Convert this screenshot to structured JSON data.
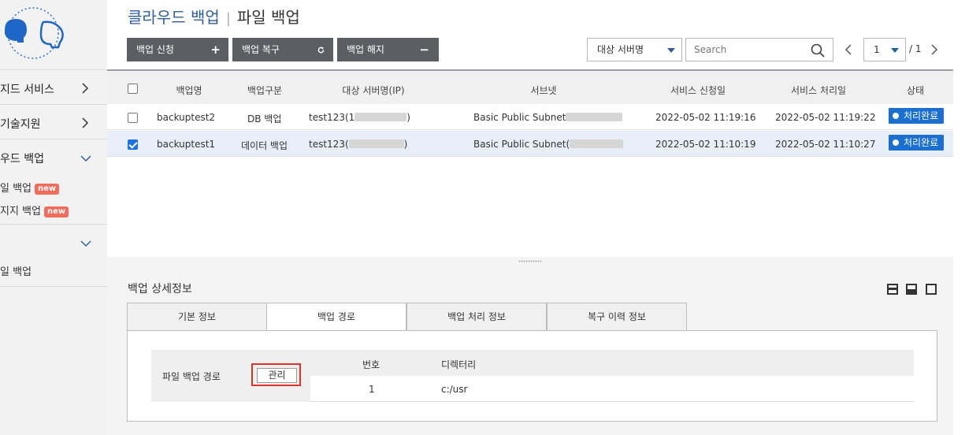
{
  "sidebar": {
    "items": [
      {
        "label": "지드 서비스"
      },
      {
        "label": "기술지원"
      },
      {
        "label": "우드 백업"
      }
    ],
    "sub_items": [
      {
        "label": "일 백업",
        "badge": "new"
      },
      {
        "label": "지지 백업",
        "badge": "new"
      }
    ],
    "bottom_item": {
      "label": "일 백업"
    }
  },
  "header": {
    "title": "클라우드 백업",
    "subtitle": "파일 백업"
  },
  "toolbar": {
    "apply_label": "백업 신청",
    "restore_label": "백업 복구",
    "cancel_label": "백업 해지",
    "server_select": "대상 서버명",
    "search_placeholder": "Search",
    "page_current": "1",
    "page_total": "/ 1"
  },
  "grid": {
    "columns": [
      "백업명",
      "백업구분",
      "대상 서버명(IP)",
      "서브넷",
      "서비스 신청일",
      "서비스 처리일",
      "상태"
    ],
    "rows": [
      {
        "name": "backuptest2",
        "type": "DB 백업",
        "server_pre": "test123(1",
        "server_post": ")",
        "subnet": "Basic Public Subnet",
        "applied": "2022-05-02 11:19:16",
        "processed": "2022-05-02 11:19:22",
        "status": "처리완료",
        "checked": false
      },
      {
        "name": "backuptest1",
        "type": "데이터 백업",
        "server_pre": "test123(",
        "server_post": ")",
        "subnet": "Basic Public Subnet(",
        "applied": "2022-05-02 11:10:19",
        "processed": "2022-05-02 11:10:27",
        "status": "처리완료",
        "checked": true
      }
    ]
  },
  "detail": {
    "title": "백업 상세정보",
    "tabs": [
      "기본 정보",
      "백업 경로",
      "백업 처리 정보",
      "복구 이력 정보"
    ],
    "active_tab": 1,
    "path_label": "파일 백업 경로",
    "manage_label": "관리",
    "dir_columns": [
      "번호",
      "디렉터리"
    ],
    "dir_rows": [
      {
        "no": "1",
        "dir": "c:/usr"
      }
    ]
  },
  "colors": {
    "brand": "#2c5ea0",
    "status": "#1a6fd1",
    "highlight": "#e0312b",
    "badge": "#f26b5b"
  }
}
